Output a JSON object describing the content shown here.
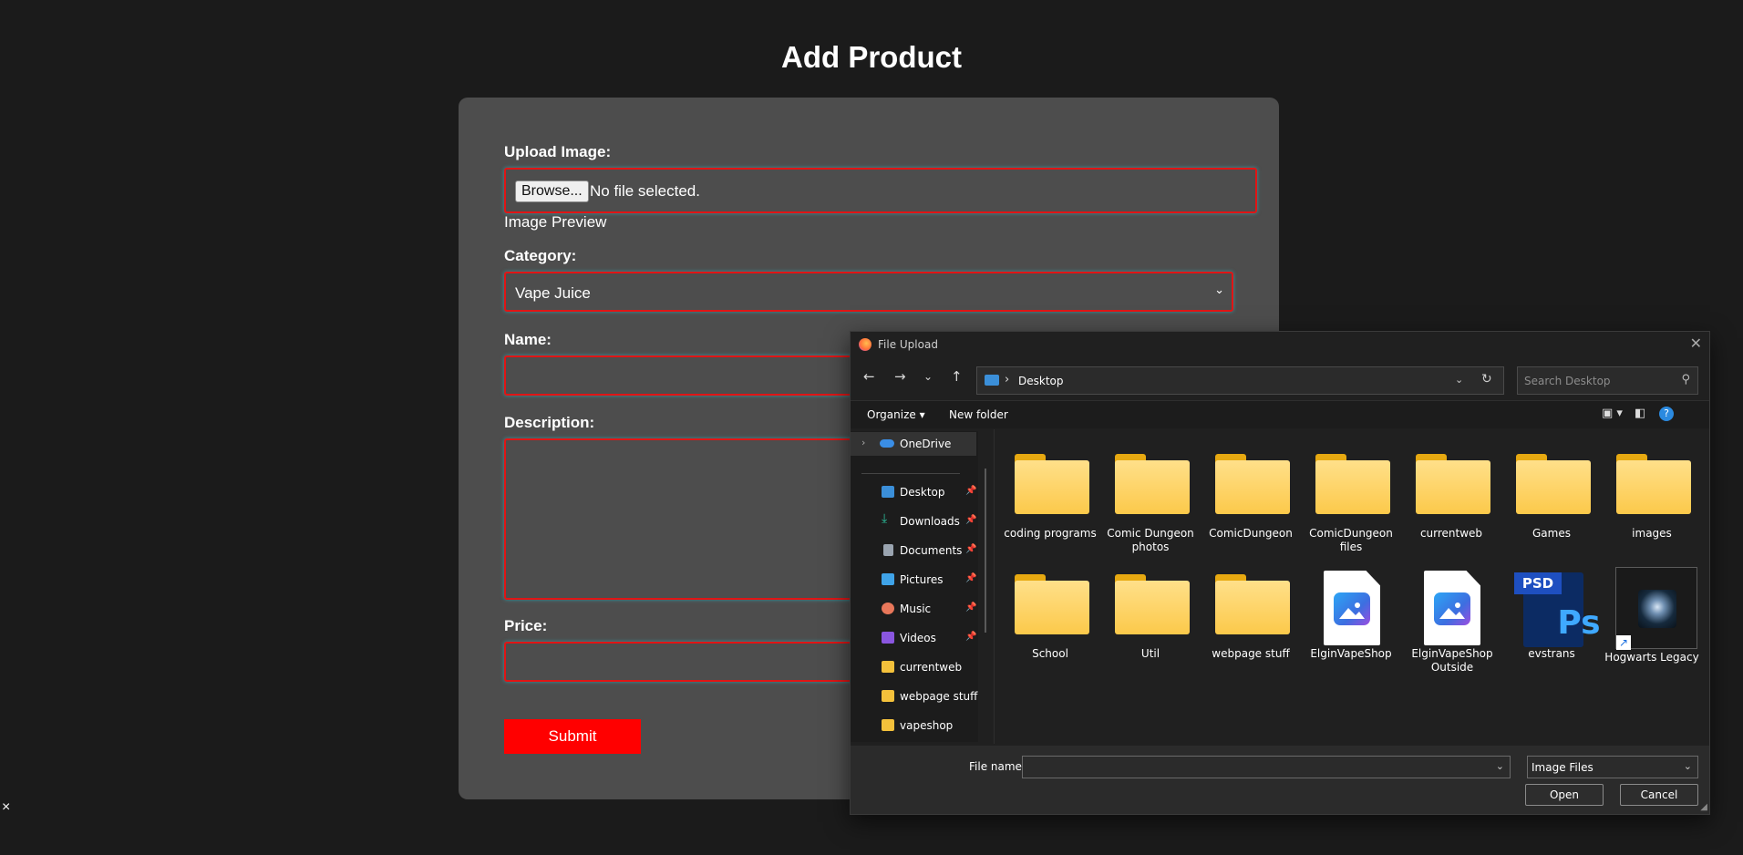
{
  "page": {
    "title": "Add Product",
    "close_glyph": "×"
  },
  "form": {
    "upload_label": "Upload Image:",
    "browse_label": "Browse...",
    "file_status": "No file selected.",
    "preview_label": "Image Preview",
    "category_label": "Category:",
    "category_value": "Vape Juice",
    "name_label": "Name:",
    "name_value": "",
    "description_label": "Description:",
    "description_value": "",
    "price_label": "Price:",
    "price_value": "",
    "submit_label": "Submit",
    "accent_color": "#ff0000"
  },
  "dialog": {
    "title": "File Upload",
    "address": {
      "path": "Desktop"
    },
    "search_placeholder": "Search Desktop",
    "toolbar": {
      "organize": "Organize ▾",
      "new_folder": "New folder",
      "help_glyph": "?"
    },
    "nav": [
      {
        "label": "OneDrive",
        "icon": "cloud-icon",
        "color": "#3a8ee6",
        "pinned": false
      },
      {
        "label": "Desktop",
        "icon": "desktop-icon",
        "color": "#3b8fd9",
        "pinned": true
      },
      {
        "label": "Downloads",
        "icon": "download-icon",
        "color": "#2cbf9c",
        "pinned": true
      },
      {
        "label": "Documents",
        "icon": "document-icon",
        "color": "#9aa4b0",
        "pinned": true
      },
      {
        "label": "Pictures",
        "icon": "picture-icon",
        "color": "#3fa3e8",
        "pinned": true
      },
      {
        "label": "Music",
        "icon": "music-icon",
        "color": "#e8775a",
        "pinned": true
      },
      {
        "label": "Videos",
        "icon": "video-icon",
        "color": "#8a56e0",
        "pinned": true
      },
      {
        "label": "currentweb",
        "icon": "folder-icon",
        "color": "#f4c13b",
        "pinned": false
      },
      {
        "label": "webpage stuff",
        "icon": "folder-icon",
        "color": "#f4c13b",
        "pinned": false
      },
      {
        "label": "vapeshop",
        "icon": "folder-icon",
        "color": "#f4c13b",
        "pinned": false
      }
    ],
    "files": [
      {
        "name": "coding programs",
        "type": "folder"
      },
      {
        "name": "Comic Dungeon photos",
        "type": "folder"
      },
      {
        "name": "ComicDungeon",
        "type": "folder"
      },
      {
        "name": "ComicDungeon files",
        "type": "folder"
      },
      {
        "name": "currentweb",
        "type": "folder"
      },
      {
        "name": "Games",
        "type": "folder"
      },
      {
        "name": "images",
        "type": "folder"
      },
      {
        "name": "School",
        "type": "folder"
      },
      {
        "name": "Util",
        "type": "folder"
      },
      {
        "name": "webpage stuff",
        "type": "folder"
      },
      {
        "name": "ElginVapeShop",
        "type": "image"
      },
      {
        "name": "ElginVapeShopOutside",
        "type": "image"
      },
      {
        "name": "evstrans",
        "type": "psd"
      },
      {
        "name": "Hogwarts Legacy",
        "type": "shortcut"
      }
    ],
    "psd_tag": "PSD",
    "psd_glyph": "Ps",
    "file_name_label": "File name:",
    "file_name_value": "",
    "file_type": "Image Files",
    "open_label": "Open",
    "cancel_label": "Cancel"
  }
}
